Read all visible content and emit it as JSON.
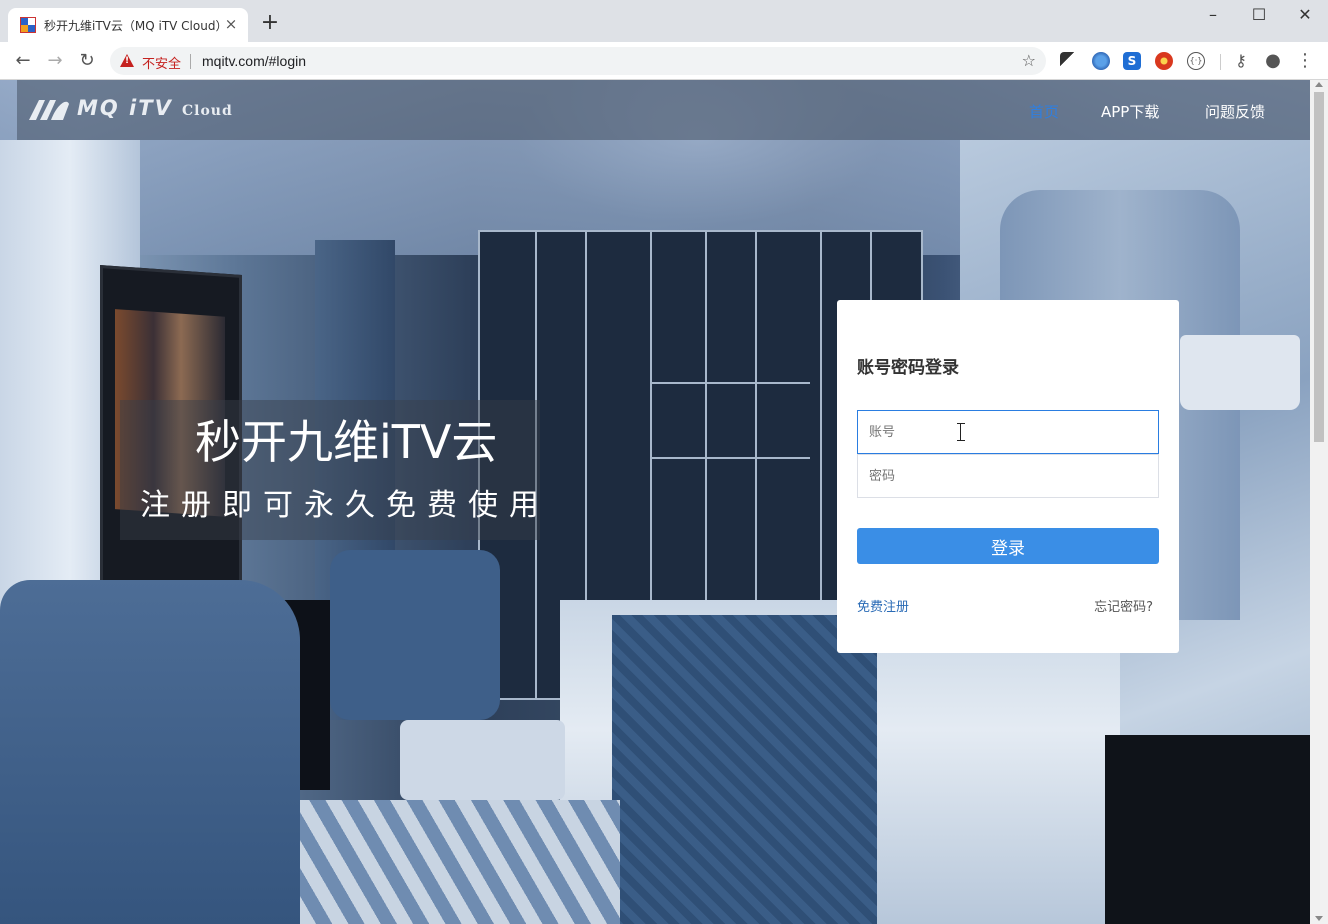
{
  "browser": {
    "tab_title": "秒开九维iTV云（MQ iTV Cloud）",
    "tab_close": "×",
    "new_tab": "+",
    "url": "mqitv.com/#login",
    "security_label": "不安全",
    "window_controls": [
      "–",
      "☐",
      "✕"
    ],
    "extensions": [
      "translate-icon",
      "globe-icon",
      "s-icon",
      "record-icon",
      "code-icon"
    ]
  },
  "header": {
    "logo_text": "MQ iTV",
    "logo_sub": "Cloud",
    "nav": [
      {
        "label": "首页",
        "active": true
      },
      {
        "label": "APP下载",
        "active": false
      },
      {
        "label": "问题反馈",
        "active": false
      }
    ]
  },
  "hero": {
    "title": "秒开九维iTV云",
    "subtitle": "注册即可永久免费使用"
  },
  "login": {
    "title": "账号密码登录",
    "account_placeholder": "账号",
    "password_placeholder": "密码",
    "submit_label": "登录",
    "register_label": "免费注册",
    "forgot_label": "忘记密码?"
  },
  "colors": {
    "accent": "#3a8ee6",
    "nav_active": "#2f7fe0",
    "link": "#2a6bb6",
    "insecure": "#c5221f"
  }
}
